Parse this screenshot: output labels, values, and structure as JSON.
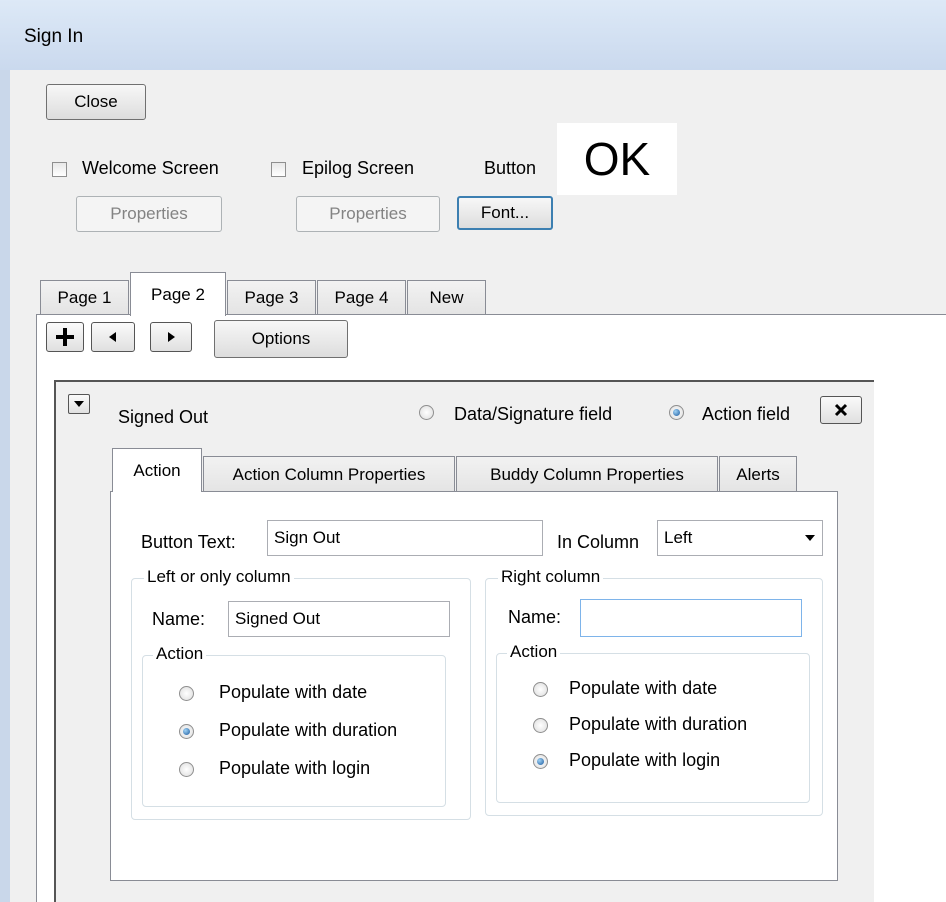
{
  "window": {
    "title": "Sign In"
  },
  "toolbar": {
    "close_label": "Close",
    "welcome_label": "Welcome Screen",
    "epilog_label": "Epilog Screen",
    "button_label": "Button",
    "ok_preview": "OK",
    "properties1": "Properties",
    "properties2": "Properties",
    "font_label": "Font..."
  },
  "pages": [
    "Page 1",
    "Page 2",
    "Page 3",
    "Page 4",
    "New"
  ],
  "page_toolbar": {
    "options_label": "Options"
  },
  "field": {
    "name": "Signed Out",
    "type_data": "Data/Signature field",
    "type_action": "Action field"
  },
  "subtabs": [
    "Action",
    "Action Column Properties",
    "Buddy Column Properties",
    "Alerts"
  ],
  "action": {
    "button_text_label": "Button Text:",
    "button_text_value": "Sign Out",
    "in_column_label": "In Column",
    "in_column_value": "Left",
    "left": {
      "legend": "Left or only column",
      "name_label": "Name:",
      "name_value": "Signed Out",
      "action_legend": "Action",
      "options": [
        "Populate with date",
        "Populate with duration",
        "Populate with login"
      ]
    },
    "right": {
      "legend": "Right column",
      "name_label": "Name:",
      "name_value": "",
      "action_legend": "Action",
      "options": [
        "Populate with date",
        "Populate with duration",
        "Populate with login"
      ]
    }
  }
}
